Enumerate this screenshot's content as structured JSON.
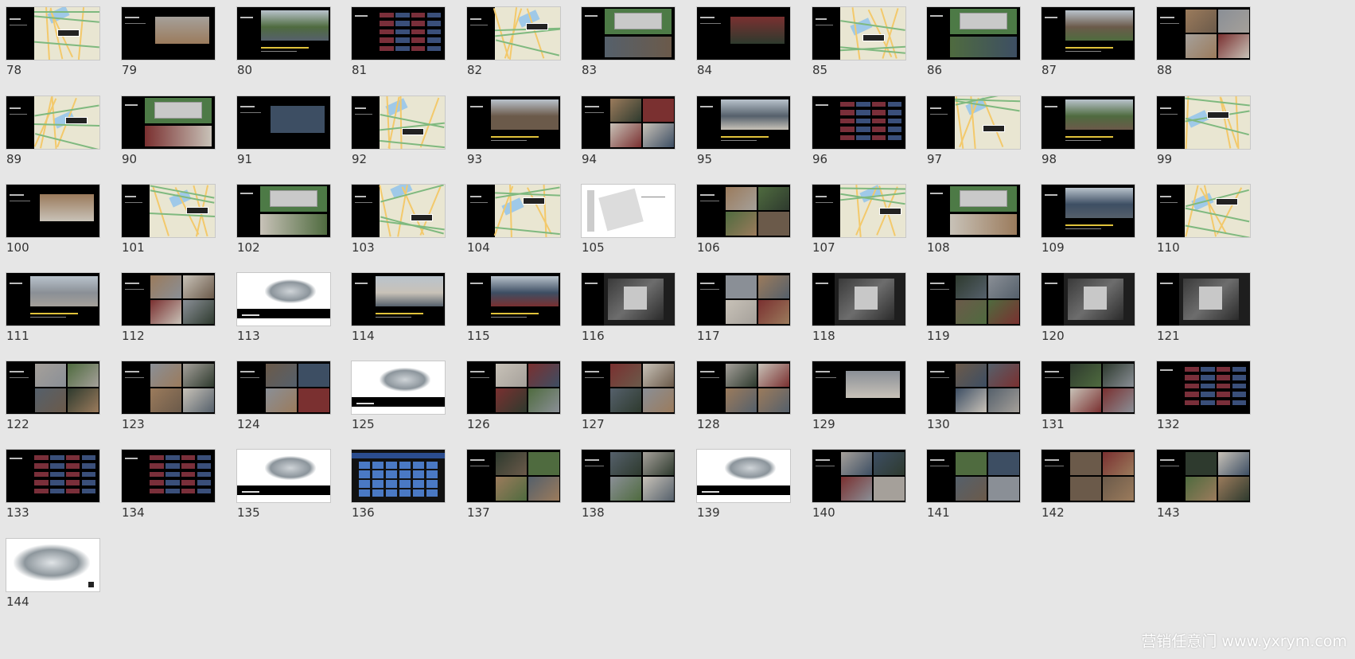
{
  "slides": [
    {
      "number": "78",
      "style": "map"
    },
    {
      "number": "79",
      "style": "photo-side"
    },
    {
      "number": "80",
      "style": "photo-wide"
    },
    {
      "number": "81",
      "style": "table-dark"
    },
    {
      "number": "82",
      "style": "map"
    },
    {
      "number": "83",
      "style": "plan"
    },
    {
      "number": "84",
      "style": "photo-side"
    },
    {
      "number": "85",
      "style": "map"
    },
    {
      "number": "86",
      "style": "plan"
    },
    {
      "number": "87",
      "style": "photo-wide"
    },
    {
      "number": "88",
      "style": "photo-grid"
    },
    {
      "number": "89",
      "style": "map"
    },
    {
      "number": "90",
      "style": "plan"
    },
    {
      "number": "91",
      "style": "photo-side"
    },
    {
      "number": "92",
      "style": "map"
    },
    {
      "number": "93",
      "style": "photo-wide"
    },
    {
      "number": "94",
      "style": "photo-grid"
    },
    {
      "number": "95",
      "style": "photo-wide"
    },
    {
      "number": "96",
      "style": "table-dark"
    },
    {
      "number": "97",
      "style": "map"
    },
    {
      "number": "98",
      "style": "photo-wide"
    },
    {
      "number": "99",
      "style": "map"
    },
    {
      "number": "100",
      "style": "photo-side"
    },
    {
      "number": "101",
      "style": "map"
    },
    {
      "number": "102",
      "style": "plan"
    },
    {
      "number": "103",
      "style": "map"
    },
    {
      "number": "104",
      "style": "map"
    },
    {
      "number": "105",
      "style": "white-plan"
    },
    {
      "number": "106",
      "style": "photo-grid"
    },
    {
      "number": "107",
      "style": "map"
    },
    {
      "number": "108",
      "style": "plan"
    },
    {
      "number": "109",
      "style": "photo-wide"
    },
    {
      "number": "110",
      "style": "map"
    },
    {
      "number": "111",
      "style": "photo-wide"
    },
    {
      "number": "112",
      "style": "photo-grid"
    },
    {
      "number": "113",
      "style": "sketch"
    },
    {
      "number": "114",
      "style": "photo-wide"
    },
    {
      "number": "115",
      "style": "photo-wide"
    },
    {
      "number": "116",
      "style": "render-dark"
    },
    {
      "number": "117",
      "style": "photo-grid"
    },
    {
      "number": "118",
      "style": "render-dark"
    },
    {
      "number": "119",
      "style": "photo-grid"
    },
    {
      "number": "120",
      "style": "render-dark"
    },
    {
      "number": "121",
      "style": "render-dark"
    },
    {
      "number": "122",
      "style": "photo-grid"
    },
    {
      "number": "123",
      "style": "photo-grid"
    },
    {
      "number": "124",
      "style": "photo-grid"
    },
    {
      "number": "125",
      "style": "sketch"
    },
    {
      "number": "126",
      "style": "photo-grid"
    },
    {
      "number": "127",
      "style": "photo-grid"
    },
    {
      "number": "128",
      "style": "photo-grid"
    },
    {
      "number": "129",
      "style": "photo-side"
    },
    {
      "number": "130",
      "style": "photo-grid"
    },
    {
      "number": "131",
      "style": "photo-grid"
    },
    {
      "number": "132",
      "style": "table-dark"
    },
    {
      "number": "133",
      "style": "table-dark"
    },
    {
      "number": "134",
      "style": "table-dark"
    },
    {
      "number": "135",
      "style": "sketch"
    },
    {
      "number": "136",
      "style": "table-blue"
    },
    {
      "number": "137",
      "style": "photo-grid"
    },
    {
      "number": "138",
      "style": "photo-grid"
    },
    {
      "number": "139",
      "style": "sketch"
    },
    {
      "number": "140",
      "style": "photo-grid"
    },
    {
      "number": "141",
      "style": "photo-grid"
    },
    {
      "number": "142",
      "style": "photo-grid"
    },
    {
      "number": "143",
      "style": "photo-grid"
    },
    {
      "number": "144",
      "style": "sketch-full"
    }
  ],
  "watermark": "营销任意门 www.yxrym.com",
  "colors": {
    "background": "#e6e6e6",
    "number_text": "#333333",
    "thumb_border": "#c8c8c8",
    "watermark": "#ffffff"
  }
}
